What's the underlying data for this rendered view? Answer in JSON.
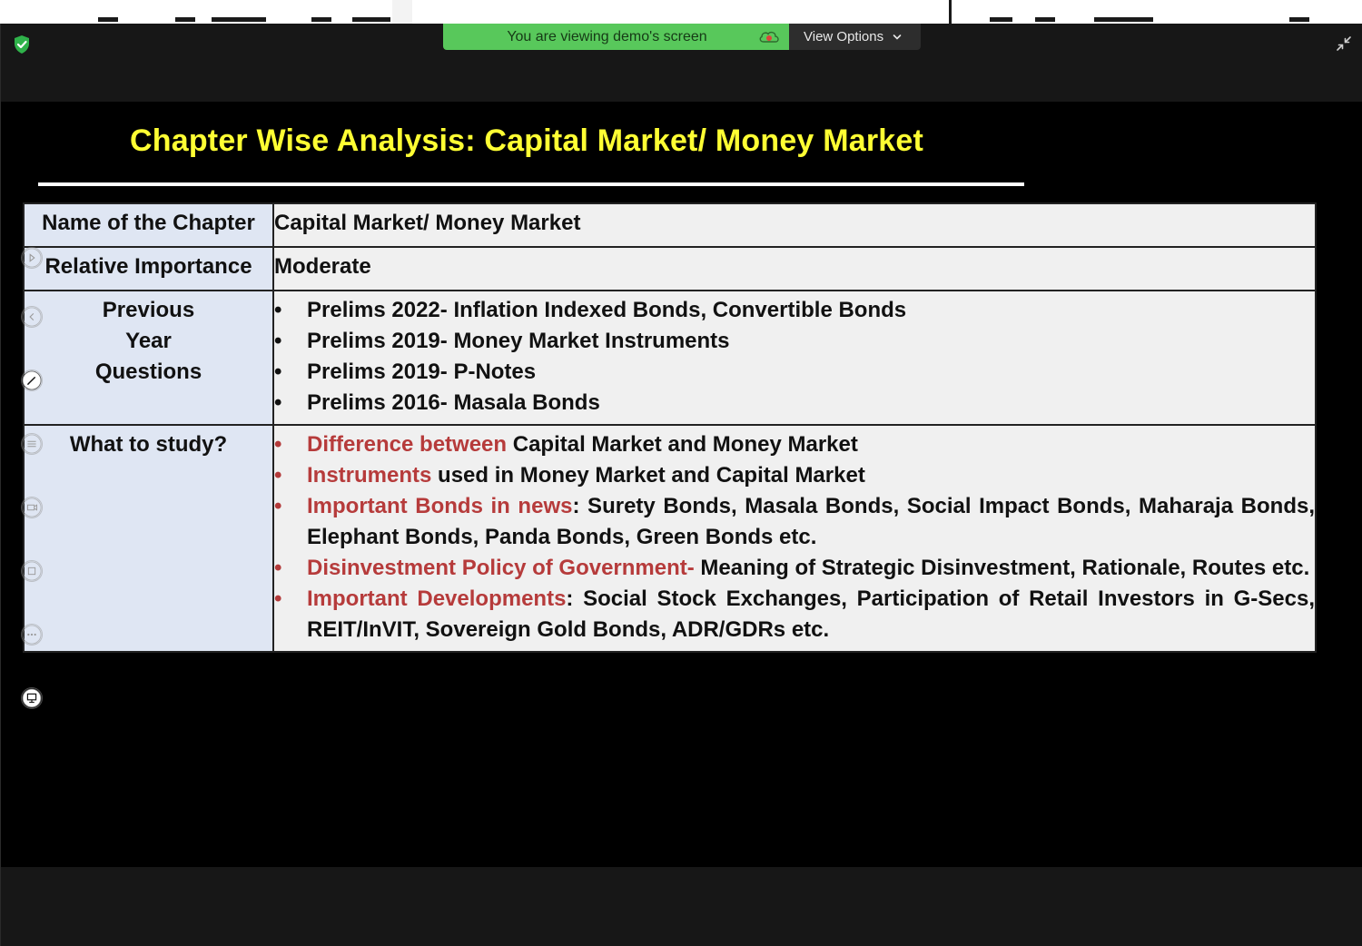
{
  "banner": {
    "viewing_text": "You are viewing demo's screen",
    "view_options_label": "View Options"
  },
  "icons": {
    "shield": "shield-check-icon",
    "cloud": "cloud-record-icon",
    "collapse": "collapse-arrows-icon",
    "chevron": "chevron-down-icon"
  },
  "colors": {
    "banner_green": "#58c85b",
    "title_yellow": "#ffff33",
    "highlight_red": "#b63b3b",
    "label_bg": "#dfe6f3"
  },
  "slide": {
    "title": "Chapter Wise Analysis: Capital Market/ Money Market",
    "rows": {
      "chapter": {
        "label": "Name of the Chapter",
        "value": "Capital Market/ Money Market"
      },
      "importance": {
        "label": "Relative Importance",
        "value": "Moderate"
      },
      "pyq": {
        "label": "Previous Year Questions",
        "items": [
          "Prelims 2022- Inflation Indexed Bonds, Convertible Bonds",
          "Prelims 2019- Money Market Instruments",
          "Prelims 2019- P-Notes",
          "Prelims 2016- Masala Bonds"
        ]
      },
      "study": {
        "label": "What to study?",
        "items": [
          {
            "highlight": "Difference between",
            "rest": " Capital Market and Money Market"
          },
          {
            "highlight": "Instruments",
            "rest": " used in Money Market and Capital Market"
          },
          {
            "highlight": "Important Bonds in news",
            "rest": ": Surety Bonds, Masala Bonds, Social Impact Bonds, Maharaja Bonds, Elephant Bonds, Panda Bonds, Green Bonds etc."
          },
          {
            "highlight": "Disinvestment Policy of Government-",
            "rest": " Meaning of Strategic Disinvestment, Rationale, Routes etc."
          },
          {
            "highlight": "Important Developments",
            "rest": ": Social Stock Exchanges, Participation of Retail Investors in G-Secs, REIT/InVIT, Sovereign Gold Bonds, ADR/GDRs etc."
          }
        ]
      }
    }
  },
  "annotation_tools": [
    "play-icon",
    "back-icon",
    "pen-icon",
    "text-icon",
    "camera-icon",
    "stamp-icon",
    "more-icon",
    "presenter-icon"
  ]
}
